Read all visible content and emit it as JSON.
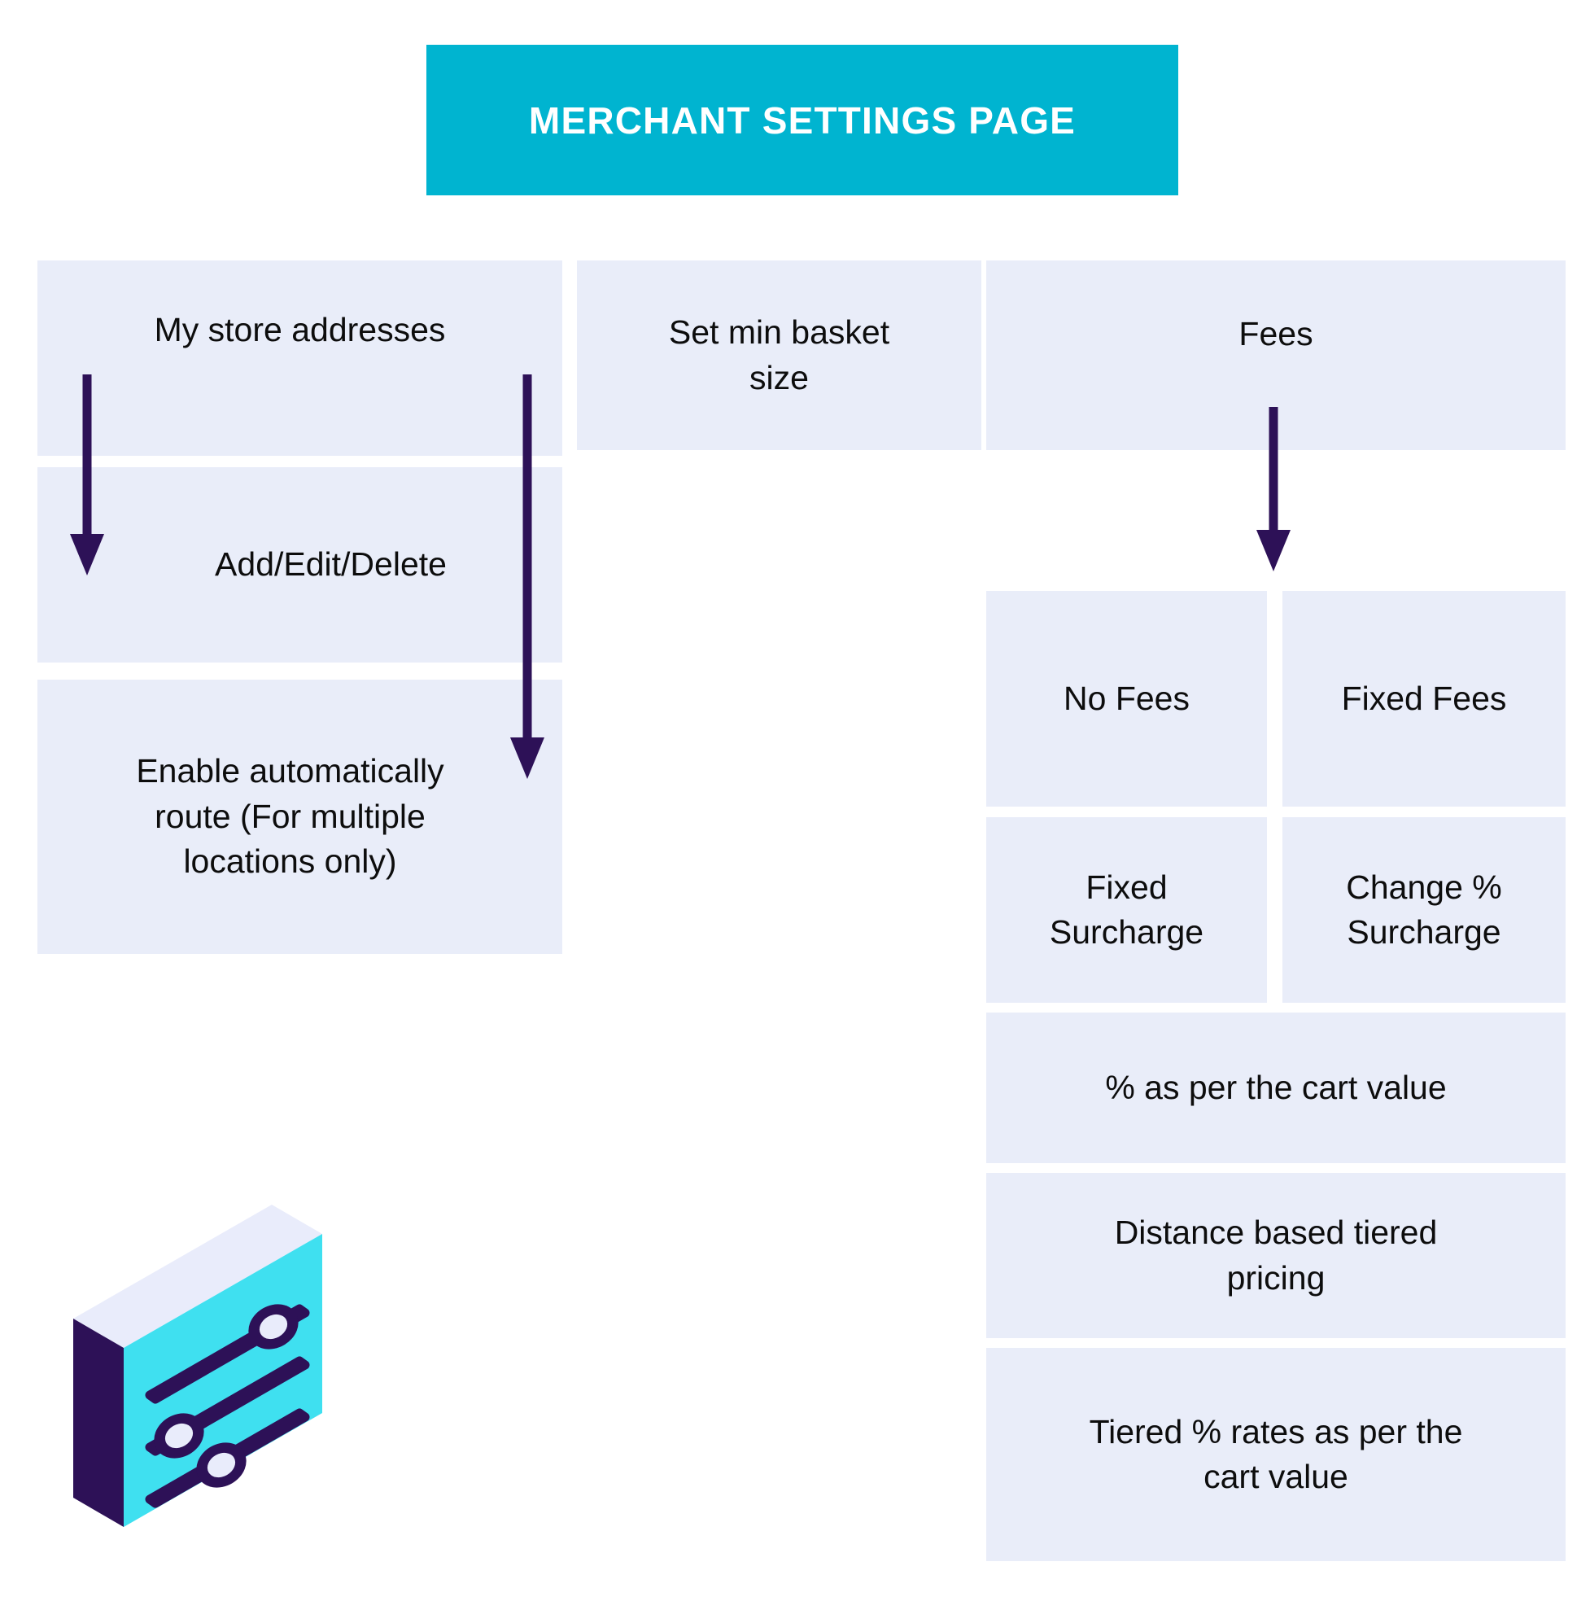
{
  "page": {
    "background": "#ffffff"
  },
  "header": {
    "title": "MERCHANT SETTINGS PAGE",
    "background_color": "#00b4d0",
    "text_color": "#ffffff"
  },
  "theme": {
    "box_fill": "#e9edf9",
    "box_text": "#0d0d0d",
    "arrow_color": "#2d1157",
    "icon_face": "#3fe0f0",
    "icon_side": "#2d1157",
    "icon_top": "#e9ecfb",
    "icon_knob": "#e9ecfb"
  },
  "columns": {
    "left": {
      "name": "store-addresses-column",
      "boxes": [
        {
          "id": "store-addresses",
          "label": "My store addresses"
        },
        {
          "id": "add-edit-delete",
          "label": "Add/Edit/Delete"
        },
        {
          "id": "auto-route",
          "label": "Enable automatically\nroute (For multiple\nlocations only)"
        }
      ]
    },
    "middle": {
      "name": "basket-size-column",
      "boxes": [
        {
          "id": "min-basket",
          "label": "Set min basket\nsize"
        }
      ]
    },
    "right": {
      "name": "fees-column",
      "parent": {
        "id": "fees",
        "label": "Fees"
      },
      "boxes": [
        {
          "id": "no-fees",
          "label": "No Fees"
        },
        {
          "id": "fixed-fees",
          "label": "Fixed Fees"
        },
        {
          "id": "fixed-surcharge",
          "label": "Fixed\nSurcharge"
        },
        {
          "id": "change-surcharge",
          "label": "Change %\nSurcharge"
        },
        {
          "id": "pct-cart",
          "label": "% as per the cart value"
        },
        {
          "id": "distance",
          "label": "Distance based tiered\npricing"
        },
        {
          "id": "tiered-pct",
          "label": "Tiered % rates as per the\ncart value"
        }
      ]
    }
  },
  "connectors": [
    {
      "id": "store-addresses-to-add-edit-delete",
      "direction": "down"
    },
    {
      "id": "store-addresses-to-auto-route",
      "direction": "down"
    },
    {
      "id": "fees-to-fee-options",
      "direction": "down"
    }
  ],
  "decoration": {
    "icon": "settings-sliders-icon",
    "description": "isometric settings sliders panel"
  }
}
